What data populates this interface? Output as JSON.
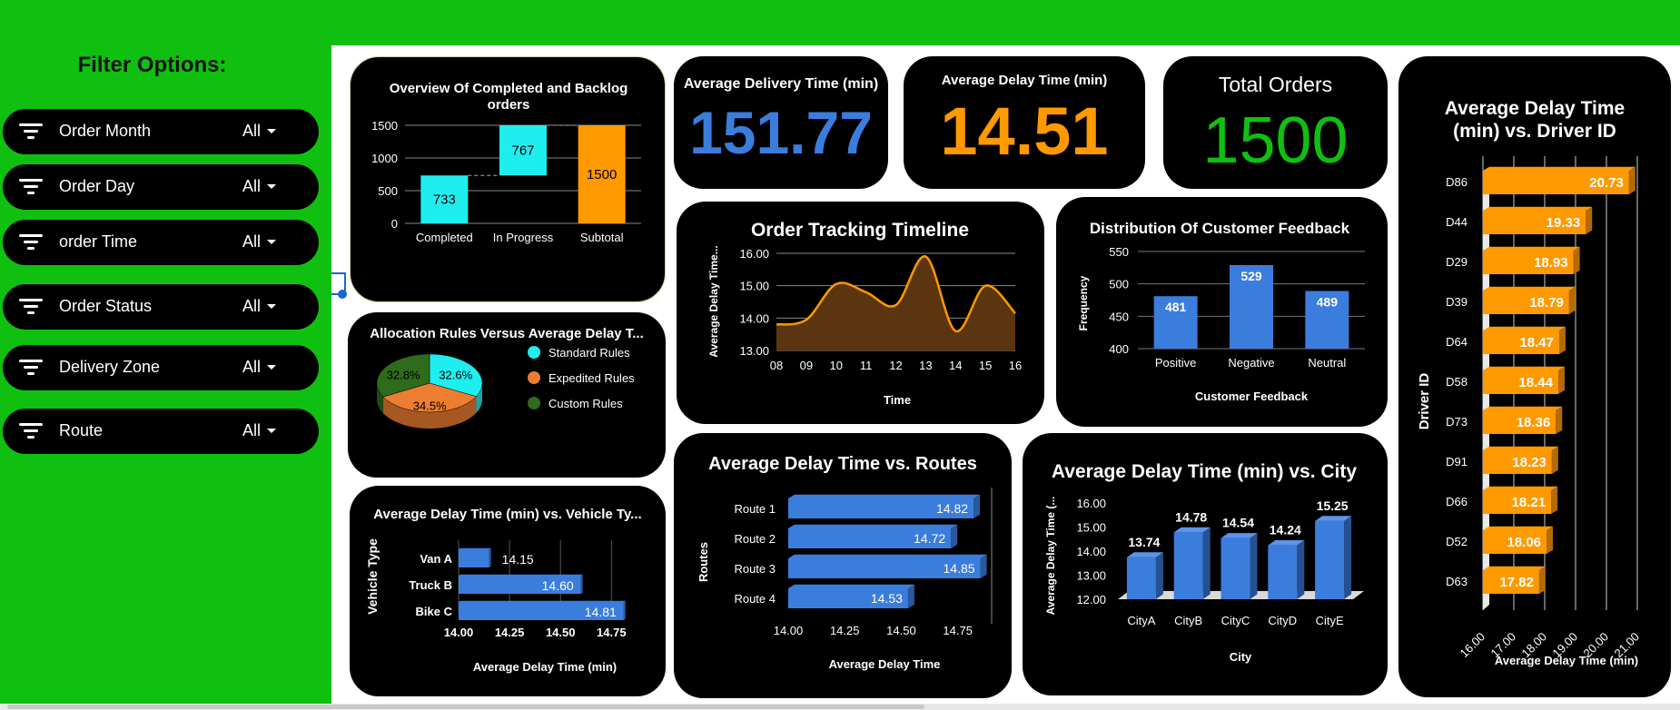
{
  "sidebar": {
    "title": "Filter Options:",
    "filters": [
      {
        "label": "Order Month",
        "value": "All"
      },
      {
        "label": "Order Day",
        "value": "All"
      },
      {
        "label": "order Time",
        "value": "All"
      },
      {
        "label": "Order Status",
        "value": "All"
      },
      {
        "label": "Delivery Zone",
        "value": "All"
      },
      {
        "label": "Route",
        "value": "All"
      }
    ]
  },
  "kpis": {
    "avg_delivery": {
      "title": "Average Delivery Time (min)",
      "value": "151.77"
    },
    "avg_delay": {
      "title": "Average Delay Time (min)",
      "value": "14.51"
    },
    "total_orders": {
      "title": "Total Orders",
      "value": "1500"
    }
  },
  "colors": {
    "green": "#10c010",
    "blue": "#3b7ddd",
    "orange": "#ff9900",
    "cyan": "#1eeeee",
    "dark_orange": "#ed7d31",
    "dark_green": "#2e6b1a"
  },
  "chart_data": [
    {
      "id": "completed_backlog",
      "type": "bar",
      "title": "Overview Of Completed and Backlog orders",
      "categories": [
        "Completed",
        "In Progress",
        "Subtotal"
      ],
      "values": [
        733,
        767,
        1500
      ],
      "labels": [
        "733",
        "767",
        "1500"
      ],
      "yticks": [
        "0",
        "500",
        "1000",
        "1500"
      ],
      "ylim": [
        0,
        1500
      ]
    },
    {
      "id": "allocation_rules",
      "type": "pie",
      "title": "Allocation Rules Versus Average Delay T...",
      "slices": [
        {
          "label": "Standard Rules",
          "value": 32.6,
          "text": "32.6%"
        },
        {
          "label": "Expedited Rules",
          "value": 34.5,
          "text": "34.5%"
        },
        {
          "label": "Custom Rules",
          "value": 32.8,
          "text": "32.8%"
        }
      ]
    },
    {
      "id": "vehicle_type",
      "type": "bar",
      "title": "Average Delay Time (min) vs. Vehicle Ty...",
      "xlabel": "Average Delay Time (min)",
      "ylabel": "Vehicle Type",
      "categories": [
        "Van A",
        "Truck B",
        "Bike C"
      ],
      "values": [
        14.15,
        14.6,
        14.81
      ],
      "labels": [
        "14.15",
        "14.60",
        "14.81"
      ],
      "xticks": [
        "14.00",
        "14.25",
        "14.50",
        "14.75"
      ],
      "xlim": [
        14.0,
        14.9
      ]
    },
    {
      "id": "timeline",
      "type": "area",
      "title": "Order Tracking Timeline",
      "xlabel": "Time",
      "ylabel": "Average Delay Time...",
      "x": [
        8,
        9,
        10,
        11,
        12,
        13,
        14,
        15,
        16
      ],
      "xticks": [
        "08",
        "09",
        "10",
        "11",
        "12",
        "13",
        "14",
        "15",
        "16"
      ],
      "values": [
        13.8,
        13.95,
        15.05,
        14.8,
        14.4,
        15.9,
        13.6,
        15.0,
        14.15
      ],
      "yticks": [
        "13.00",
        "14.00",
        "15.00",
        "16.00"
      ],
      "ylim": [
        13,
        16
      ]
    },
    {
      "id": "feedback",
      "type": "bar",
      "title": "Distribution Of Customer Feedback",
      "xlabel": "Customer Feedback",
      "ylabel": "Frequency",
      "categories": [
        "Positive",
        "Negative",
        "Neutral"
      ],
      "values": [
        481,
        529,
        489
      ],
      "labels": [
        "481",
        "529",
        "489"
      ],
      "yticks": [
        "400",
        "450",
        "500",
        "550"
      ],
      "ylim": [
        400,
        550
      ]
    },
    {
      "id": "routes",
      "type": "bar",
      "title": "Average Delay Time vs. Routes",
      "xlabel": "Average Delay Time",
      "ylabel": "Routes",
      "categories": [
        "Route 1",
        "Route 2",
        "Route 3",
        "Route 4"
      ],
      "values": [
        14.82,
        14.72,
        14.85,
        14.53
      ],
      "labels": [
        "14.82",
        "14.72",
        "14.85",
        "14.53"
      ],
      "xticks": [
        "14.00",
        "14.25",
        "14.50",
        "14.75"
      ],
      "xlim": [
        14.0,
        14.9
      ]
    },
    {
      "id": "city",
      "type": "bar",
      "title": "Average Delay Time (min) vs. City",
      "xlabel": "City",
      "ylabel": "Average Delay Time (...",
      "categories": [
        "CityA",
        "CityB",
        "CityC",
        "CityD",
        "CityE"
      ],
      "values": [
        13.74,
        14.78,
        14.54,
        14.24,
        15.25
      ],
      "labels": [
        "13.74",
        "14.78",
        "14.54",
        "14.24",
        "15.25"
      ],
      "yticks": [
        "12.00",
        "13.00",
        "14.00",
        "15.00",
        "16.00"
      ],
      "ylim": [
        12,
        16
      ]
    },
    {
      "id": "driver",
      "type": "bar",
      "title": "Average Delay Time (min) vs. Driver ID",
      "xlabel": "Average Delay Time (min)",
      "ylabel": "Driver ID",
      "categories": [
        "D86",
        "D44",
        "D29",
        "D39",
        "D64",
        "D58",
        "D73",
        "D91",
        "D66",
        "D52",
        "D63"
      ],
      "values": [
        20.73,
        19.33,
        18.93,
        18.79,
        18.47,
        18.44,
        18.36,
        18.23,
        18.21,
        18.06,
        17.82
      ],
      "labels": [
        "20.73",
        "19.33",
        "18.93",
        "18.79",
        "18.47",
        "18.44",
        "18.36",
        "18.23",
        "18.21",
        "18.06",
        "17.82"
      ],
      "xticks": [
        "16.00",
        "17.00",
        "18.00",
        "19.00",
        "20.00",
        "21.00"
      ],
      "xlim": [
        16,
        21
      ]
    }
  ]
}
